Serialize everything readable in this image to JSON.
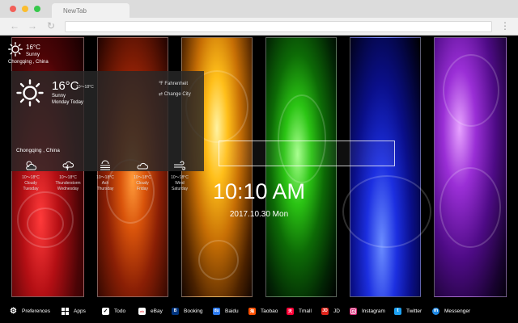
{
  "browser": {
    "tab_title": "NewTab",
    "back_icon": "←",
    "forward_icon": "→",
    "reload_icon": "↻",
    "menu_icon": "⋮"
  },
  "mini_weather": {
    "temp": "16°C",
    "condition": "Sunny",
    "city": "Chongqing , China"
  },
  "weather_card": {
    "temp": "16°C",
    "range": "10～18°C",
    "condition": "Sunny",
    "day": "Monday Today",
    "unit_toggle": "℉ Fahrenheit",
    "change_city": "⇄ Change City",
    "city": "Chongqing , China",
    "forecast": [
      {
        "icon": "cloudy-sun-icon",
        "range": "10～18°C",
        "label": "Cloudy",
        "day": "Tuesday"
      },
      {
        "icon": "thunderstorm-icon",
        "range": "10～18°C",
        "label": "Thunderstorm",
        "day": "Wednesday"
      },
      {
        "icon": "ash-icon",
        "range": "10～18°C",
        "label": "Ash",
        "day": "Thursday"
      },
      {
        "icon": "cloudy-icon",
        "range": "10～18°C",
        "label": "Cloudy",
        "day": "Friday"
      },
      {
        "icon": "wind-icon",
        "range": "10～18°C",
        "label": "Wind",
        "day": "Saturday"
      }
    ]
  },
  "search": {
    "placeholder": ""
  },
  "clock": {
    "time": "10:10 AM",
    "date": "2017.10.30 Mon"
  },
  "bottom_bar": {
    "items": [
      {
        "label": "Preferences",
        "icon": "gear-icon",
        "color": "#000000"
      },
      {
        "label": "Apps",
        "icon": "grid-icon",
        "color": "#000000"
      },
      {
        "label": "Todo",
        "icon": "checkbox-icon",
        "color": "#ffffff"
      },
      {
        "label": "eBay",
        "icon": "ebay-icon",
        "color": "#ffffff"
      },
      {
        "label": "Booking",
        "icon": "booking-icon",
        "color": "#003580"
      },
      {
        "label": "Baidu",
        "icon": "baidu-icon",
        "color": "#2d7bf0"
      },
      {
        "label": "Taobao",
        "icon": "taobao-icon",
        "color": "#ff5000"
      },
      {
        "label": "Tmall",
        "icon": "tmall-icon",
        "color": "#ff0036"
      },
      {
        "label": "JD",
        "icon": "jd-icon",
        "color": "#e1251b"
      },
      {
        "label": "Instagram",
        "icon": "instagram-icon",
        "color": "#d62976"
      },
      {
        "label": "Twitter",
        "icon": "twitter-icon",
        "color": "#1da1f2"
      },
      {
        "label": "Messenger",
        "icon": "messenger-icon",
        "color": "#1e88e5"
      }
    ]
  }
}
